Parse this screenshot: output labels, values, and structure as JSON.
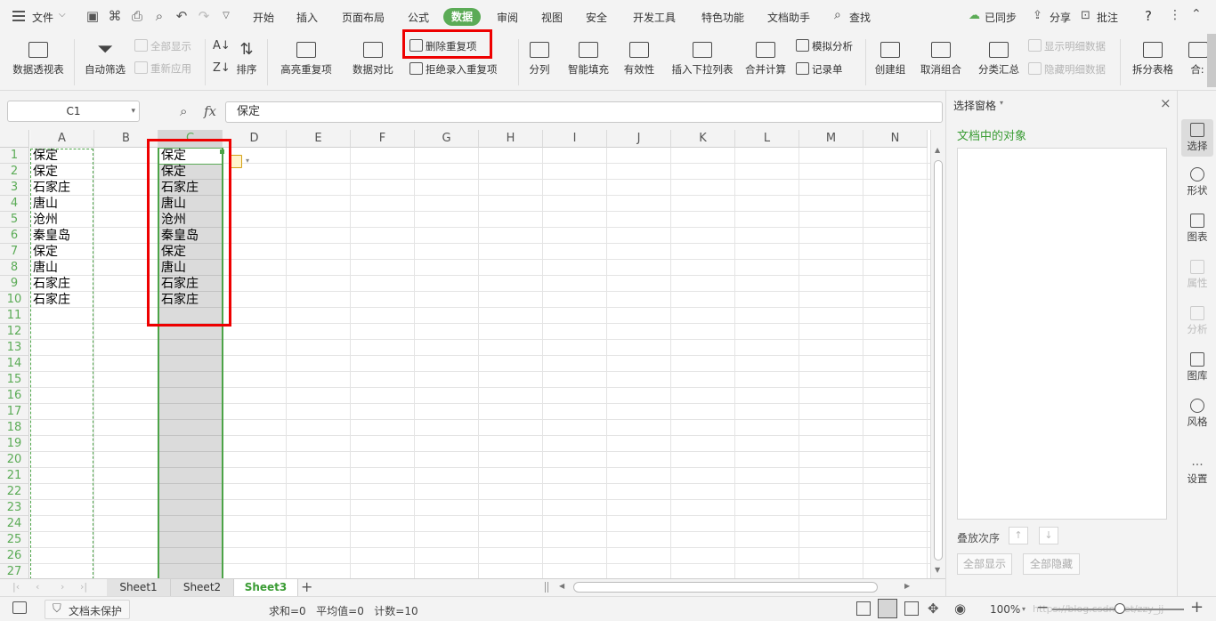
{
  "topbar": {
    "file_label": "文件",
    "tabs": [
      "开始",
      "插入",
      "页面布局",
      "公式",
      "数据",
      "审阅",
      "视图",
      "安全",
      "开发工具",
      "特色功能",
      "文档助手"
    ],
    "search_label": "查找",
    "synced_label": "已同步",
    "share_label": "分享",
    "comment_label": "批注",
    "help_label": "?"
  },
  "ribbon": {
    "pivot": "数据透视表",
    "autofilter": "自动筛选",
    "show_all": "全部显示",
    "reapply": "重新应用",
    "sort": "排序",
    "highlight_dup": "高亮重复项",
    "compare": "数据对比",
    "remove_dup": "删除重复项",
    "reject_dup": "拒绝录入重复项",
    "split": "分列",
    "smart_fill": "智能填充",
    "validity": "有效性",
    "insert_dropdown": "插入下拉列表",
    "consolidate": "合并计算",
    "what_if": "模拟分析",
    "record_form": "记录单",
    "create_group": "创建组",
    "ungroup": "取消组合",
    "subtotal": "分类汇总",
    "show_detail": "显示明细数据",
    "hide_detail": "隐藏明细数据",
    "split_table": "拆分表格",
    "more": "合:"
  },
  "formula_bar": {
    "name_box": "C1",
    "fx": "fx",
    "value": "保定"
  },
  "columns": [
    "A",
    "B",
    "C",
    "D",
    "E",
    "F",
    "G",
    "H",
    "I",
    "J",
    "K",
    "L",
    "M",
    "N"
  ],
  "rows": [
    "1",
    "2",
    "3",
    "4",
    "5",
    "6",
    "7",
    "8",
    "9",
    "10",
    "11",
    "12",
    "13",
    "14",
    "15",
    "16",
    "17",
    "18",
    "19",
    "20",
    "21",
    "22",
    "23",
    "24",
    "25",
    "26",
    "27"
  ],
  "col_a": [
    "保定",
    "保定",
    "石家庄",
    "唐山",
    "沧州",
    "秦皇岛",
    "保定",
    "唐山",
    "石家庄",
    "石家庄"
  ],
  "col_c": [
    "保定",
    "保定",
    "石家庄",
    "唐山",
    "沧州",
    "秦皇岛",
    "保定",
    "唐山",
    "石家庄",
    "石家庄"
  ],
  "right_panel": {
    "title": "选择窗格",
    "objects_label": "文档中的对象",
    "stack_order": "叠放次序",
    "show_all": "全部显示",
    "hide_all": "全部隐藏"
  },
  "sidebar": [
    "选择",
    "形状",
    "图表",
    "属性",
    "分析",
    "图库",
    "风格",
    "设置"
  ],
  "sheets": [
    "Sheet1",
    "Sheet2",
    "Sheet3"
  ],
  "status": {
    "protect": "文档未保护",
    "summary": "求和=0   平均值=0   计数=10",
    "zoom": "100%",
    "watermark": "https://blog.csdn.net/zzy_jj"
  },
  "colors": {
    "accent": "#5bab56",
    "highlight": "#e00000"
  }
}
